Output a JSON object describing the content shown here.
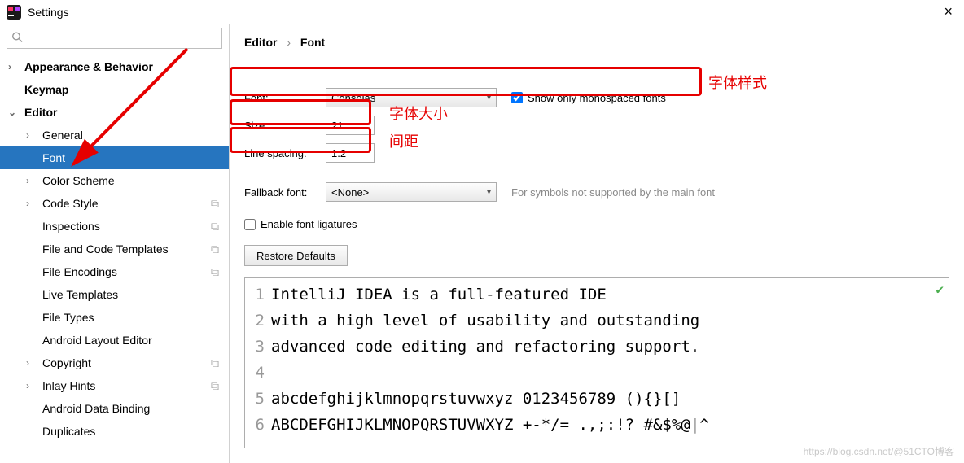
{
  "window": {
    "title": "Settings"
  },
  "search": {
    "placeholder": ""
  },
  "tree": {
    "appearance": "Appearance & Behavior",
    "keymap": "Keymap",
    "editor": "Editor",
    "general": "General",
    "font": "Font",
    "color_scheme": "Color Scheme",
    "code_style": "Code Style",
    "inspections": "Inspections",
    "file_code_templates": "File and Code Templates",
    "file_encodings": "File Encodings",
    "live_templates": "Live Templates",
    "file_types": "File Types",
    "android_layout": "Android Layout Editor",
    "copyright": "Copyright",
    "inlay_hints": "Inlay Hints",
    "android_binding": "Android Data Binding",
    "duplicates": "Duplicates"
  },
  "breadcrumb": {
    "a": "Editor",
    "b": "Font"
  },
  "form": {
    "font_label": "Font:",
    "font_value": "Consolas",
    "monospaced": "Show only monospaced fonts",
    "size_label": "Size:",
    "size_value": "21",
    "lsp_label": "Line spacing:",
    "lsp_value": "1.2",
    "fallback_label": "Fallback font:",
    "fallback_value": "<None>",
    "fallback_hint": "For symbols not supported by the main font",
    "ligatures": "Enable font ligatures",
    "restore": "Restore Defaults"
  },
  "annotations": {
    "font_style": "字体样式",
    "font_size": "字体大小",
    "line_spacing": "间距"
  },
  "preview": {
    "l1": "IntelliJ IDEA is a full-featured IDE",
    "l2": "with a high level of usability and outstanding",
    "l3": "advanced code editing and refactoring support.",
    "l4": "",
    "l5": "abcdefghijklmnopqrstuvwxyz 0123456789 (){}[]",
    "l6": "ABCDEFGHIJKLMNOPQRSTUVWXYZ +-*/= .,;:!? #&$%@|^"
  },
  "watermark": "https://blog.csdn.net/@51CTO博客"
}
